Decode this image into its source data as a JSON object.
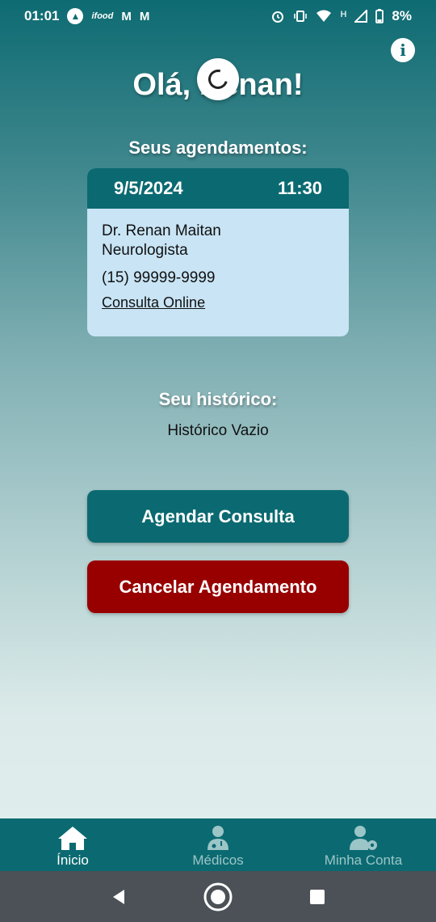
{
  "status_bar": {
    "time": "01:01",
    "battery": "8%",
    "network_label": "H",
    "icons": [
      "app-circle-icon",
      "ifood-icon",
      "gmail-icon",
      "gmail-icon",
      "alarm-icon",
      "vibrate-icon",
      "wifi-icon",
      "signal-icon",
      "battery-icon"
    ],
    "ifood_label": "ifood",
    "gmail_label": "M"
  },
  "header": {
    "greeting": "Olá, Renan!",
    "info_icon": "info-icon"
  },
  "appointments": {
    "title": "Seus agendamentos:",
    "items": [
      {
        "date": "9/5/2024",
        "time": "11:30",
        "doctor": "Dr. Renan Maitan",
        "specialty": "Neurologista",
        "phone": "(15) 99999-9999",
        "type": "Consulta Online"
      }
    ]
  },
  "history": {
    "title": "Seu histórico:",
    "empty_text": "Histórico Vazio"
  },
  "actions": {
    "schedule_label": "Agendar Consulta",
    "cancel_label": "Cancelar Agendamento"
  },
  "bottom_nav": {
    "items": [
      {
        "label": "Ínicio",
        "icon": "home-icon",
        "active": true
      },
      {
        "label": "Médicos",
        "icon": "doctor-icon",
        "active": false
      },
      {
        "label": "Minha Conta",
        "icon": "user-settings-icon",
        "active": false
      }
    ]
  },
  "colors": {
    "primary": "#0b6a71",
    "danger": "#980000",
    "card": "#c8e4f5",
    "nav_inactive": "#9cc5c7"
  }
}
